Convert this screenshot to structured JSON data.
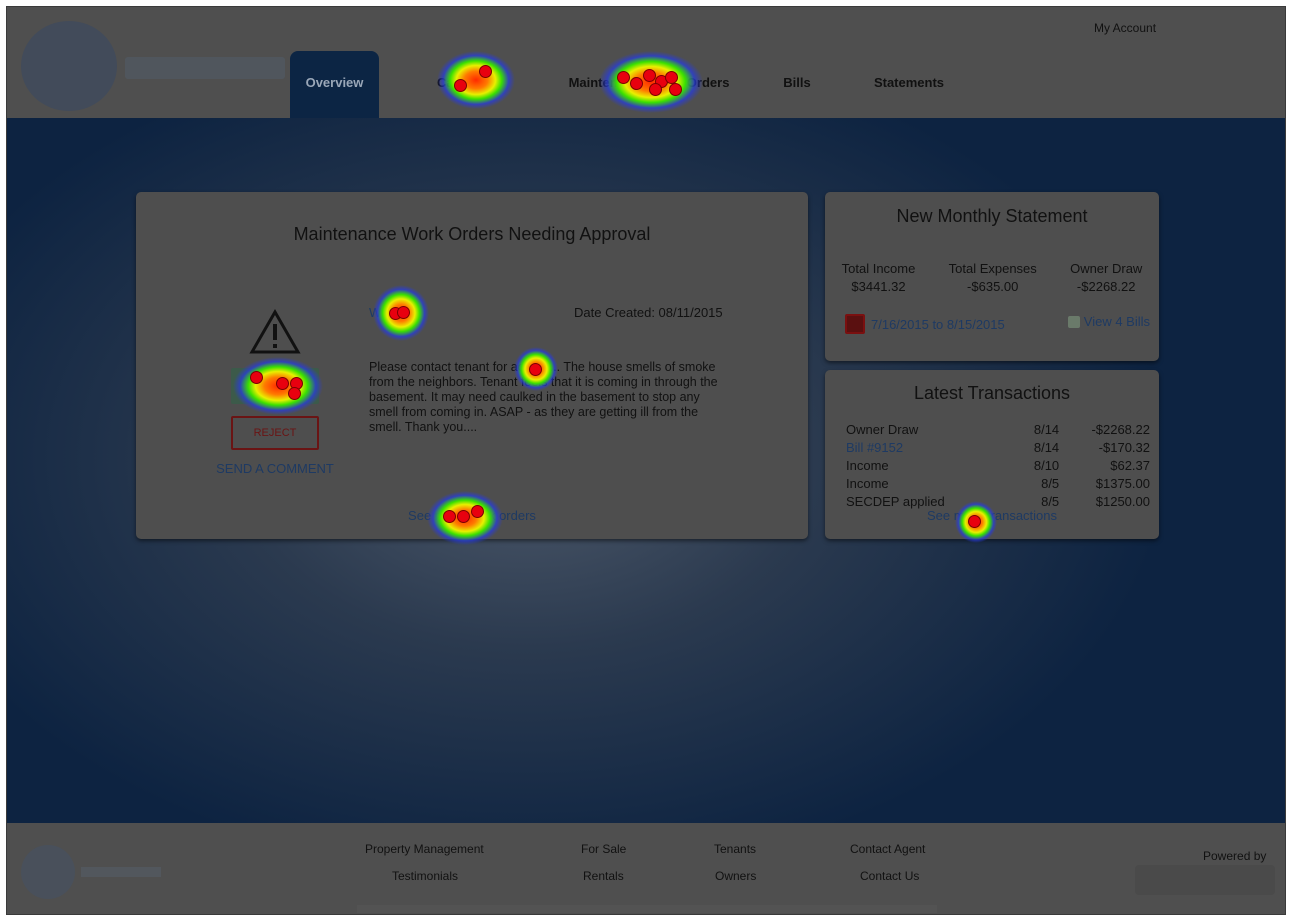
{
  "header": {
    "my_account": "My Account",
    "tabs": [
      {
        "label": "Overview",
        "active": true
      },
      {
        "label": "Cash Flow",
        "active": false
      },
      {
        "label": "Maintenance Work Orders",
        "active": false
      },
      {
        "label": "Bills",
        "active": false
      },
      {
        "label": "Statements",
        "active": false
      }
    ]
  },
  "work_orders": {
    "title": "Maintenance Work Orders Needing Approval",
    "warning_icon": "warning-triangle-icon",
    "approve_label": "",
    "reject_label": "REJECT",
    "comment_label": "SEND A COMMENT",
    "order_id": "W...4",
    "date_created": "Date Created: 08/11/2015",
    "description": "Please contact tenant for access... The house smells of smoke from the neighbors. Tenant feels that it is coming in through the basement. It may need caulked in the basement to stop any smell from coming in. ASAP - as they are getting ill from the smell. Thank you....",
    "see_more": "See more work orders"
  },
  "statement": {
    "title": "New Monthly Statement",
    "columns": [
      {
        "label": "Total Income",
        "value": "$3441.32"
      },
      {
        "label": "Total Expenses",
        "value": "-$635.00"
      },
      {
        "label": "Owner Draw",
        "value": "-$2268.22"
      }
    ],
    "date_range": "7/16/2015 to 8/15/2015",
    "pdf_icon": "pdf-icon",
    "view_bills": "View 4 Bills",
    "bill_icon": "bill-icon"
  },
  "transactions": {
    "title": "Latest Transactions",
    "rows": [
      {
        "desc": "Owner Draw",
        "date": "8/14",
        "amount": "-$2268.22",
        "link": false
      },
      {
        "desc": "Bill #9152",
        "date": "8/14",
        "amount": "-$170.32",
        "link": true
      },
      {
        "desc": "Income",
        "date": "8/10",
        "amount": "$62.37",
        "link": false
      },
      {
        "desc": "Income",
        "date": "8/5",
        "amount": "$1375.00",
        "link": false
      },
      {
        "desc": "SECDEP applied",
        "date": "8/5",
        "amount": "$1250.00",
        "link": false
      }
    ],
    "see_more": "See more transactions"
  },
  "footer": {
    "links": [
      "Property Management",
      "Testimonials",
      "For Sale",
      "Rentals",
      "Tenants",
      "Owners",
      "Contact Agent",
      "Contact Us"
    ],
    "powered_by": "Powered by"
  },
  "colors": {
    "nav_active": "#0c2544",
    "link": "#1e3a63",
    "reject": "#6a1414",
    "heat_hot": "#ff2a00"
  }
}
